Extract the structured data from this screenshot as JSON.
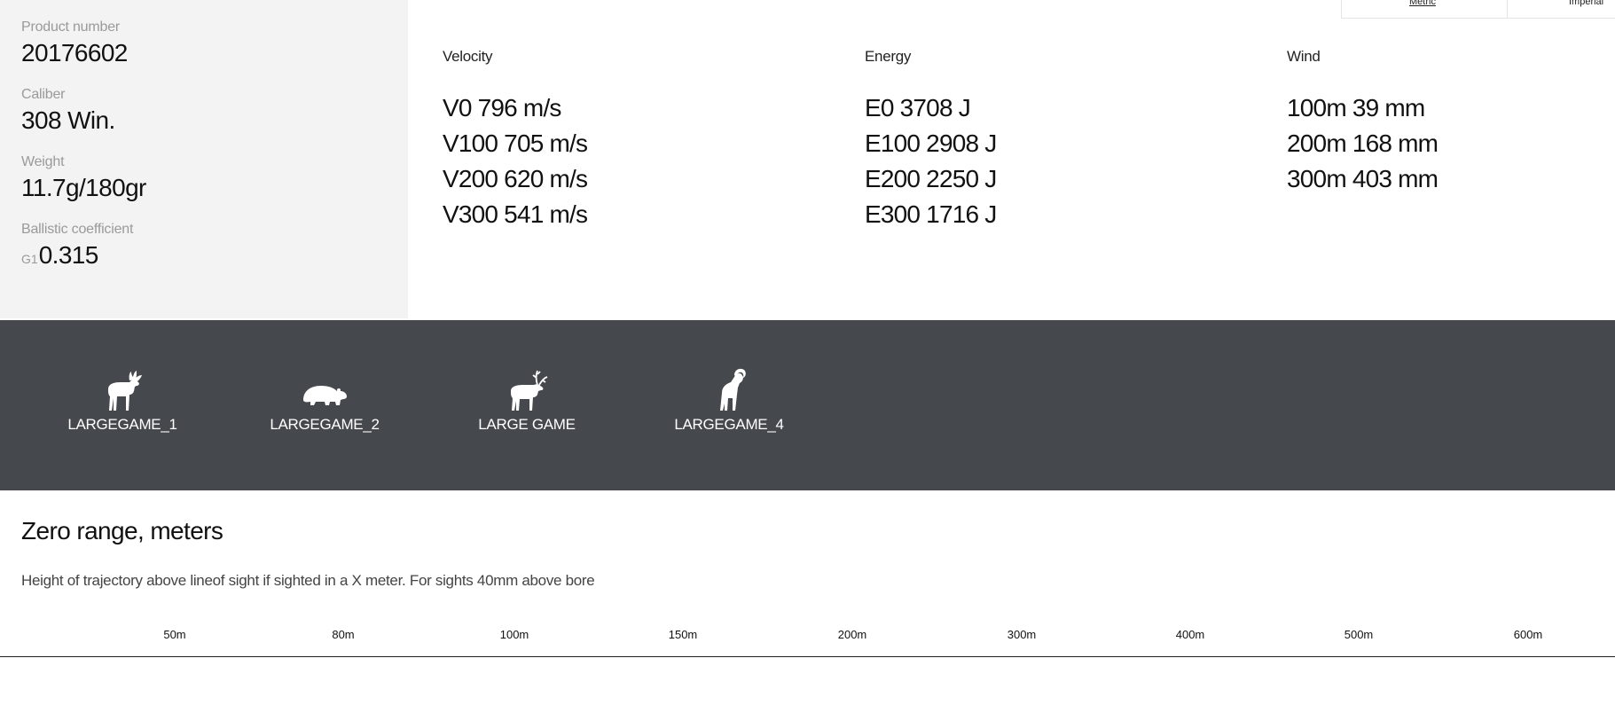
{
  "specs": {
    "product_number": {
      "label": "Product number",
      "value": "20176602"
    },
    "caliber": {
      "label": "Caliber",
      "value": "308 Win."
    },
    "weight": {
      "label": "Weight",
      "value": "11.7g/180gr"
    },
    "ballistic": {
      "label": "Ballistic coefficient",
      "prefix": "G1",
      "value": "0.315"
    }
  },
  "units": {
    "metric": "Metric",
    "imperial": "Imperial"
  },
  "velocity": {
    "title": "Velocity",
    "lines": [
      "V0 796 m/s",
      "V100 705 m/s",
      "V200 620 m/s",
      "V300 541 m/s"
    ]
  },
  "energy": {
    "title": "Energy",
    "lines": [
      "E0 3708 J",
      "E100 2908 J",
      "E200 2250 J",
      "E300 1716 J"
    ]
  },
  "wind": {
    "title": "Wind",
    "lines": [
      "100m 39 mm",
      "200m 168 mm",
      "300m 403 mm"
    ]
  },
  "games": [
    {
      "label": "LARGEGAME_1",
      "icon": "moose-icon"
    },
    {
      "label": "LARGEGAME_2",
      "icon": "bear-icon"
    },
    {
      "label": "LARGE GAME",
      "icon": "reindeer-icon"
    },
    {
      "label": "LARGEGAME_4",
      "icon": "bighorn-sheep-icon"
    }
  ],
  "zero_range": {
    "title": "Zero range, meters",
    "description": "Height of trajectory above lineof sight if sighted in a X meter. For sights 40mm above bore",
    "ranges": [
      "50m",
      "80m",
      "100m",
      "150m",
      "200m",
      "300m",
      "400m",
      "500m",
      "600m"
    ]
  },
  "colors": {
    "band": "#45484d",
    "panel": "#f3f3f3"
  }
}
